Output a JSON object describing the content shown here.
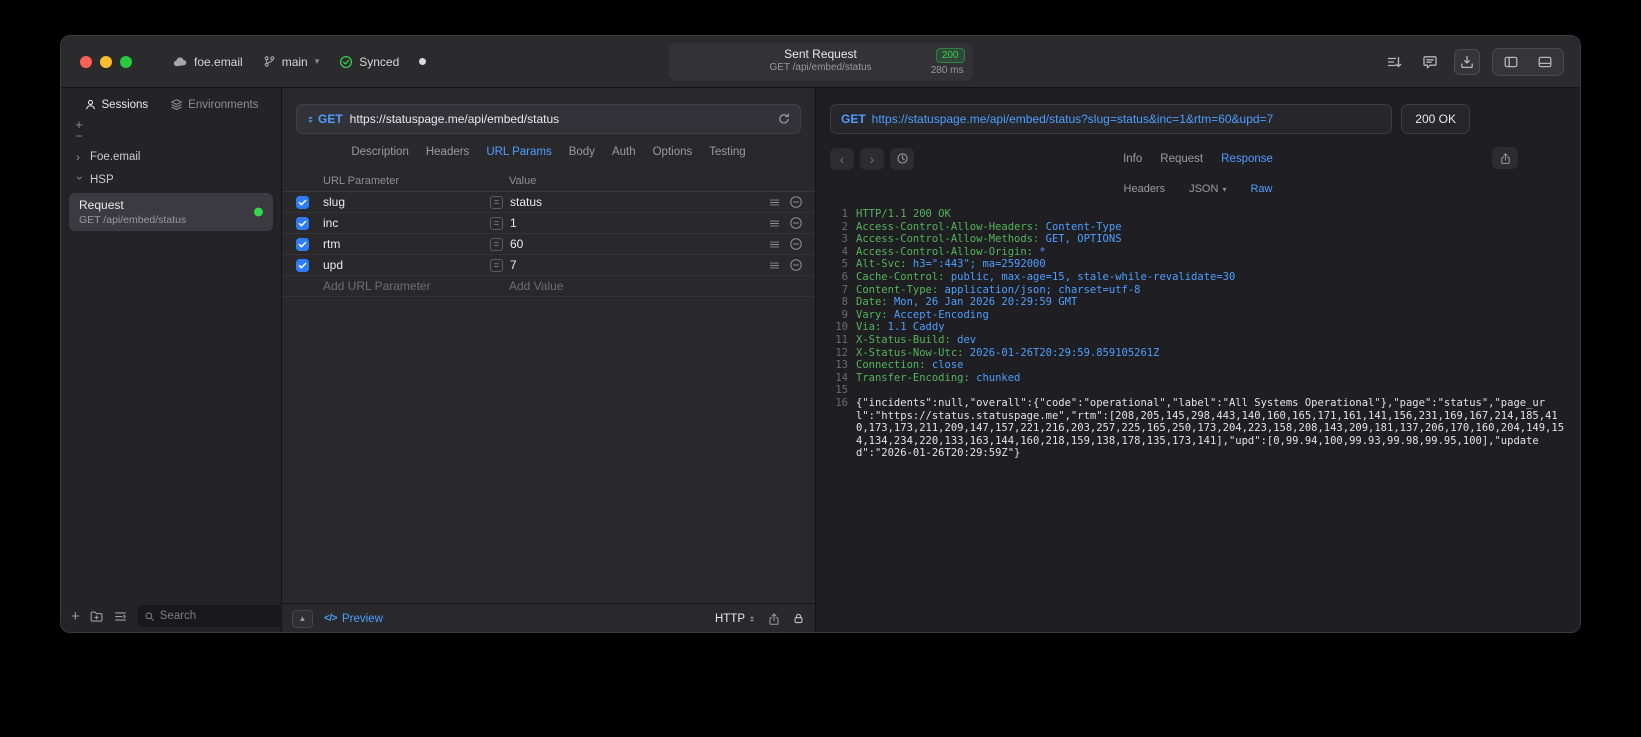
{
  "titlebar": {
    "workspace": "foe.email",
    "branch": "main",
    "sync_status": "Synced",
    "request": {
      "title": "Sent Request",
      "status_code": "200",
      "subtitle": "GET /api/embed/status",
      "duration": "280 ms"
    }
  },
  "sidebar": {
    "tabs": {
      "sessions": "Sessions",
      "environments": "Environments"
    },
    "tree": {
      "group1": "Foe.email",
      "group2": "HSP"
    },
    "request_item": {
      "title": "Request",
      "subtitle": "GET /api/embed/status"
    },
    "search_placeholder": "Search"
  },
  "request_editor": {
    "method": "GET",
    "url": "https://statuspage.me/api/embed/status",
    "tabs": [
      "Description",
      "Headers",
      "URL Params",
      "Body",
      "Auth",
      "Options",
      "Testing"
    ],
    "active_tab": "URL Params",
    "params": {
      "col_key": "URL Parameter",
      "col_value": "Value",
      "rows": [
        {
          "key": "slug",
          "value": "status",
          "checked": true
        },
        {
          "key": "inc",
          "value": "1",
          "checked": true
        },
        {
          "key": "rtm",
          "value": "60",
          "checked": true
        },
        {
          "key": "upd",
          "value": "7",
          "checked": true
        }
      ],
      "add_key": "Add URL Parameter",
      "add_value": "Add Value"
    },
    "footer": {
      "preview": "Preview",
      "protocol": "HTTP"
    }
  },
  "response_viewer": {
    "method": "GET",
    "url": "https://statuspage.me/api/embed/status?slug=status&inc=1&rtm=60&upd=7",
    "status": "200 OK",
    "tabs": [
      "Info",
      "Request",
      "Response"
    ],
    "active_tab": "Response",
    "subtabs": {
      "headers": "Headers",
      "json": "JSON",
      "raw": "Raw"
    },
    "active_subtab": "Raw",
    "lines": [
      {
        "n": "1",
        "key": "HTTP/1.1 200 OK",
        "val": ""
      },
      {
        "n": "2",
        "key": "Access-Control-Allow-Headers:",
        "val": "Content-Type"
      },
      {
        "n": "3",
        "key": "Access-Control-Allow-Methods:",
        "val": "GET, OPTIONS"
      },
      {
        "n": "4",
        "key": "Access-Control-Allow-Origin:",
        "val": "*"
      },
      {
        "n": "5",
        "key": "Alt-Svc:",
        "val": "h3=\":443\"; ma=2592000"
      },
      {
        "n": "6",
        "key": "Cache-Control:",
        "val": "public, max-age=15, stale-while-revalidate=30"
      },
      {
        "n": "7",
        "key": "Content-Type:",
        "val": "application/json; charset=utf-8"
      },
      {
        "n": "8",
        "key": "Date:",
        "val": "Mon, 26 Jan 2026 20:29:59 GMT"
      },
      {
        "n": "9",
        "key": "Vary:",
        "val": "Accept-Encoding"
      },
      {
        "n": "10",
        "key": "Via:",
        "val": "1.1 Caddy"
      },
      {
        "n": "11",
        "key": "X-Status-Build:",
        "val": "dev"
      },
      {
        "n": "12",
        "key": "X-Status-Now-Utc:",
        "val": "2026-01-26T20:29:59.859105261Z"
      },
      {
        "n": "13",
        "key": "Connection:",
        "val": "close"
      },
      {
        "n": "14",
        "key": "Transfer-Encoding:",
        "val": "chunked"
      },
      {
        "n": "15",
        "key": "",
        "val": ""
      }
    ],
    "body_line_number": "16",
    "body": "{\"incidents\":null,\"overall\":{\"code\":\"operational\",\"label\":\"All Systems Operational\"},\"page\":\"status\",\"page_url\":\"https://status.statuspage.me\",\"rtm\":[208,205,145,298,443,140,160,165,171,161,141,156,231,169,167,214,185,410,173,173,211,209,147,157,221,216,203,257,225,165,250,173,204,223,158,208,143,209,181,137,206,170,160,204,149,154,134,234,220,133,163,144,160,218,159,138,178,135,173,141],\"upd\":[0,99.94,100,99.93,99.98,99.95,100],\"updated\":\"2026-01-26T20:29:59Z\"}"
  },
  "colors": {
    "accent_blue": "#4D9EFF",
    "success_green": "#32D74B",
    "header_key_green": "#53B457"
  }
}
